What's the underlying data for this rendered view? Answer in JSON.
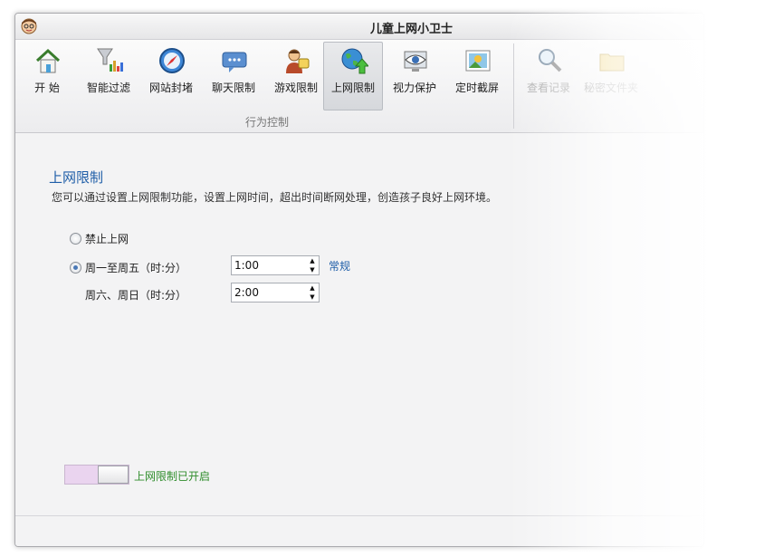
{
  "window": {
    "title": "儿童上网小卫士"
  },
  "ribbon": {
    "items": [
      {
        "label": "开  始",
        "icon": "home-icon"
      },
      {
        "label": "智能过滤",
        "icon": "filter-chart-icon"
      },
      {
        "label": "网站封堵",
        "icon": "compass-icon"
      },
      {
        "label": "聊天限制",
        "icon": "chat-bubble-icon"
      },
      {
        "label": "游戏限制",
        "icon": "game-player-icon"
      },
      {
        "label": "上网限制",
        "icon": "globe-up-arrow-icon"
      },
      {
        "label": "视力保护",
        "icon": "eye-monitor-icon"
      },
      {
        "label": "定时截屏",
        "icon": "screenshot-picture-icon"
      },
      {
        "label": "查看记录",
        "icon": "magnifier-icon"
      },
      {
        "label": "秘密文件夹",
        "icon": "folder-lock-icon"
      }
    ],
    "group_label": "行为控制"
  },
  "content": {
    "title": "上网限制",
    "description": "您可以通过设置上网限制功能，设置上网时间，超出时间断网处理，创造孩子良好上网环境。",
    "option_block": "禁止上网",
    "option_weekday": "周一至周五（时:分）",
    "weekday_value": "1:00",
    "mode_link": "常规",
    "weekend_label": "周六、周日（时:分）",
    "weekend_value": "2:00",
    "status_text": "上网限制已开启"
  },
  "colors": {
    "accent": "#1f5ea8",
    "status_green": "#2f8d2b",
    "toggle_bg": "#ead4ef"
  }
}
